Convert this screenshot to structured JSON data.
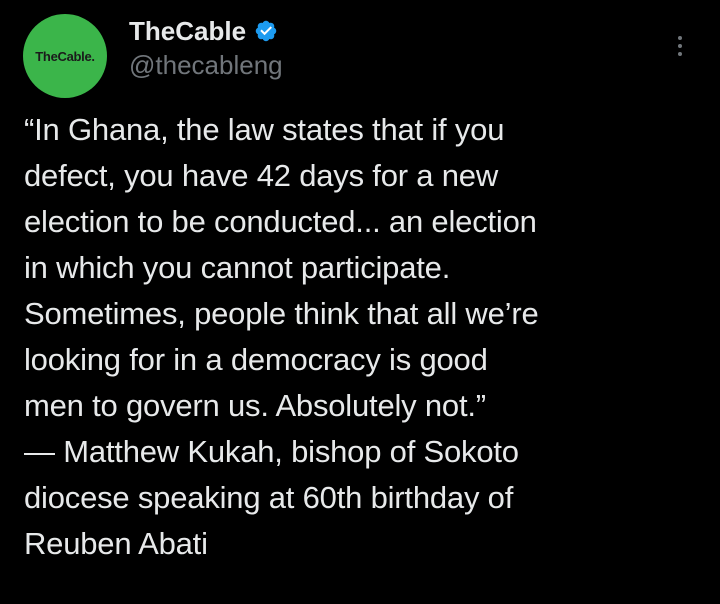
{
  "account": {
    "avatar_text": "TheCable.",
    "display_name": "TheCable",
    "handle": "@thecableng",
    "verified_icon": "verified-badge-icon",
    "avatar_color": "#3bb54a",
    "verified_color": "#1d9bf0"
  },
  "menu": {
    "icon": "more-options-icon"
  },
  "tweet": {
    "text": "“In Ghana, the law states that if you\ndefect, you have 42 days for a new\nelection to be conducted... an election\nin which you cannot participate.\nSometimes, people think that all we’re\nlooking for in a democracy is good\nmen to govern us. Absolutely not.”\n— Matthew Kukah, bishop of Sokoto\ndiocese speaking at 60th birthday of\nReuben Abati"
  }
}
